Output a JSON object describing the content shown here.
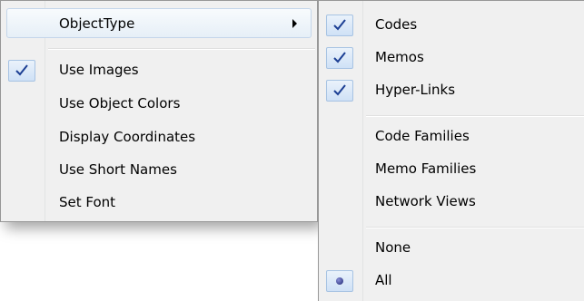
{
  "left_menu": {
    "object_type": "ObjectType",
    "use_images": "Use Images",
    "use_object_colors": "Use Object Colors",
    "display_coordinates": "Display Coordinates",
    "use_short_names": "Use Short Names",
    "set_font": "Set Font"
  },
  "right_menu": {
    "codes": "Codes",
    "memos": "Memos",
    "hyper_links": "Hyper-Links",
    "code_families": "Code Families",
    "memo_families": "Memo Families",
    "network_views": "Network Views",
    "none": "None",
    "all": "All"
  },
  "states": {
    "use_images_checked": true,
    "codes_checked": true,
    "memos_checked": true,
    "hyper_links_checked": true,
    "all_selected": true
  },
  "colors": {
    "menu_bg": "#f0f0f0",
    "highlight_border": "#c4d6ea",
    "check_color": "#1c3f94"
  }
}
